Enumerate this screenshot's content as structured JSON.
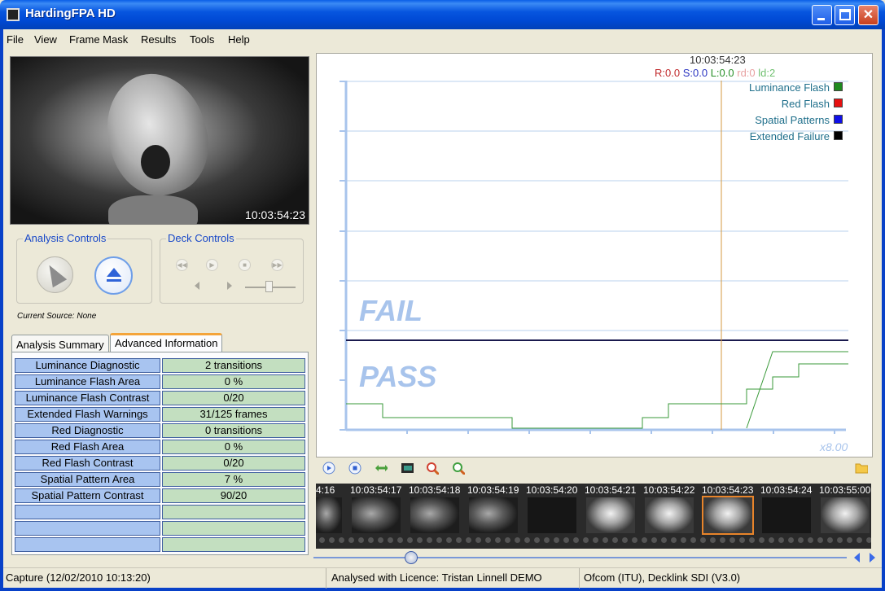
{
  "window": {
    "title": "HardingFPA HD"
  },
  "menu": [
    "File",
    "View",
    "Frame Mask",
    "Results",
    "Tools",
    "Help"
  ],
  "preview": {
    "timecode": "10:03:54:23"
  },
  "analysis_controls": {
    "title": "Analysis Controls"
  },
  "deck_controls": {
    "title": "Deck Controls",
    "slider_level": 0.5
  },
  "current_source": "Current Source: None",
  "tabs": [
    "Analysis Summary",
    "Advanced Information"
  ],
  "active_tab": "Advanced Information",
  "advanced_info": [
    {
      "label": "Luminance Diagnostic",
      "value": "2 transitions"
    },
    {
      "label": "Luminance Flash Area",
      "value": "0 %"
    },
    {
      "label": "Luminance Flash Contrast",
      "value": "0/20"
    },
    {
      "label": "Extended Flash Warnings",
      "value": "31/125 frames"
    },
    {
      "label": "Red Diagnostic",
      "value": "0 transitions"
    },
    {
      "label": "Red Flash Area",
      "value": "0 %"
    },
    {
      "label": "Red Flash Contrast",
      "value": "0/20"
    },
    {
      "label": "Spatial Pattern Area",
      "value": "7 %"
    },
    {
      "label": "Spatial Pattern Contrast",
      "value": "90/20"
    },
    {
      "label": "",
      "value": ""
    },
    {
      "label": "",
      "value": ""
    },
    {
      "label": "",
      "value": ""
    }
  ],
  "graph": {
    "cursor_timecode": "10:03:54:23",
    "readout": {
      "r": "R:0.0",
      "s": "S:0.0",
      "l": "L:0.0",
      "rd": "rd:0",
      "ld": "ld:2"
    },
    "legend": [
      {
        "name": "Luminance Flash",
        "color": "#1e8a1e"
      },
      {
        "name": "Red Flash",
        "color": "#e81010"
      },
      {
        "name": "Spatial Patterns",
        "color": "#1010e8"
      },
      {
        "name": "Extended Failure",
        "color": "#000000"
      }
    ],
    "fail_label": "FAIL",
    "pass_label": "PASS",
    "zoom": "x8.00",
    "colors": {
      "text": "#1f6f8b",
      "grid": "#b8d0ee",
      "threshold": "#1a1a4e",
      "cursor": "#d49a40",
      "axis": "#a8c4ec",
      "label": "#a8c4ec"
    }
  },
  "filmstrip": {
    "timecodes": [
      "4:16",
      "10:03:54:17",
      "10:03:54:18",
      "10:03:54:19",
      "10:03:54:20",
      "10:03:54:21",
      "10:03:54:22",
      "10:03:54:23",
      "10:03:54:24",
      "10:03:55:00"
    ]
  },
  "status": {
    "capture": "Capture (12/02/2010 10:13:20)",
    "licence": "Analysed with Licence: Tristan Linnell DEMO",
    "standard": "Ofcom (ITU), Decklink SDI (V3.0)"
  }
}
